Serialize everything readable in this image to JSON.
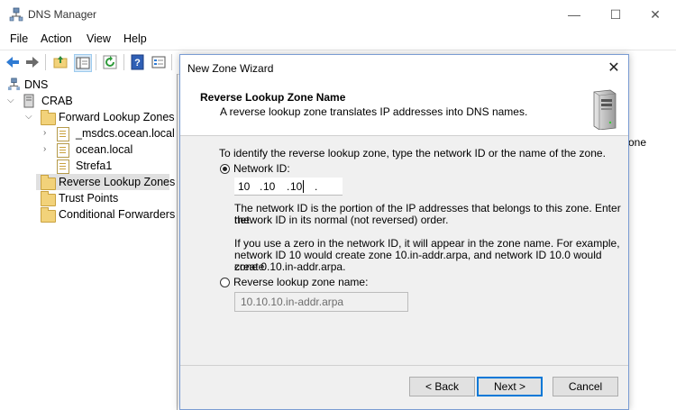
{
  "window": {
    "title": "DNS Manager",
    "minimize": "—",
    "maximize": "☐",
    "close": "✕"
  },
  "menu": [
    "File",
    "Action",
    "View",
    "Help"
  ],
  "toolbar": {
    "buttons": [
      "back-arrow-icon",
      "forward-arrow-icon",
      "up-folder-icon",
      "show-hide-tree-icon",
      "refresh-icon",
      "help-icon",
      "properties-icon"
    ]
  },
  "tree": {
    "root": "DNS",
    "server": "CRAB",
    "forward": "Forward Lookup Zones",
    "forward_children": [
      "_msdcs.ocean.local",
      "ocean.local",
      "Strefa1"
    ],
    "reverse": "Reverse Lookup Zones",
    "trust": "Trust Points",
    "conditional": "Conditional Forwarders"
  },
  "right_pane": {
    "text": "one"
  },
  "wizard": {
    "title": "New Zone Wizard",
    "close": "✕",
    "header_title": "Reverse Lookup Zone Name",
    "header_sub": "A reverse lookup zone translates IP addresses into DNS names.",
    "intro": "To identify the reverse lookup zone, type the network ID or the name of the zone.",
    "network_id_label": "Network ID:",
    "network_id": [
      "10",
      "10",
      "10",
      ""
    ],
    "help1_line1": "The network ID is the portion of the IP addresses that belongs to this zone. Enter the",
    "help1_line2": "network ID in its normal (not reversed) order.",
    "help2_line1": "If you use a zero in the network ID, it will appear in the zone name. For example,",
    "help2_line2": "network ID 10 would create zone 10.in-addr.arpa, and network ID 10.0 would create",
    "help2_line3": "zone 0.10.in-addr.arpa.",
    "zone_name_label": "Reverse lookup zone name:",
    "zone_name_value": "10.10.10.in-addr.arpa",
    "back_label": "< Back",
    "next_label": "Next >",
    "cancel_label": "Cancel",
    "selected_option": "network-id"
  }
}
